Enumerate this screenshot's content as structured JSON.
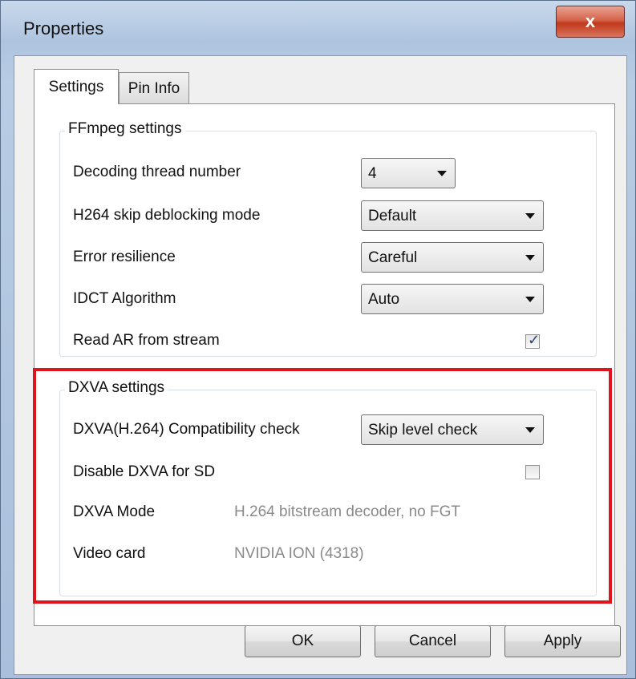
{
  "window": {
    "title": "Properties",
    "close_glyph": "x"
  },
  "tabs": [
    {
      "label": "Settings",
      "active": true
    },
    {
      "label": "Pin Info",
      "active": false
    }
  ],
  "ffmpeg": {
    "title": "FFmpeg settings",
    "thread_label": "Decoding thread number",
    "thread_value": "4",
    "deblock_label": "H264 skip deblocking mode",
    "deblock_value": "Default",
    "error_label": "Error resilience",
    "error_value": "Careful",
    "idct_label": "IDCT Algorithm",
    "idct_value": "Auto",
    "ar_label": "Read AR from stream",
    "ar_checked": true
  },
  "dxva": {
    "title": "DXVA settings",
    "compat_label": "DXVA(H.264) Compatibility check",
    "compat_value": "Skip level check",
    "disable_label": "Disable DXVA for SD",
    "disable_checked": false,
    "mode_label": "DXVA Mode",
    "mode_value": "H.264 bitstream decoder, no FGT",
    "card_label": "Video card",
    "card_value": "NVIDIA ION  (4318)"
  },
  "buttons": {
    "ok": "OK",
    "cancel": "Cancel",
    "apply": "Apply"
  },
  "colors": {
    "highlight": "#e0141b",
    "close_button": "#c0391b"
  }
}
